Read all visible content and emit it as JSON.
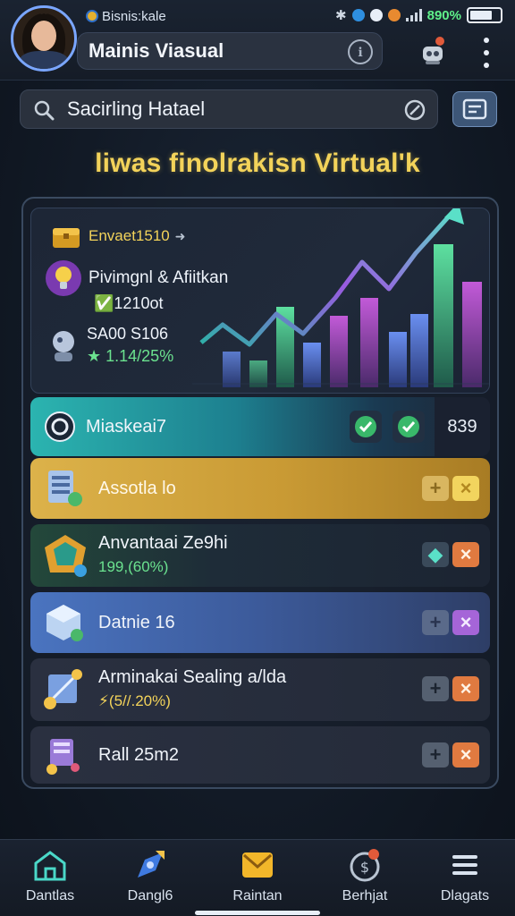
{
  "status": {
    "app_label": "Bisnis:kale",
    "battery_text": "890%"
  },
  "header": {
    "title": "Mainis Viasual"
  },
  "search": {
    "value": "Sacirling Hatael"
  },
  "headline": "liwas finolrakisn Virtual'k",
  "hero": {
    "badge": "Envaet1510",
    "line1": "Pivimgnl & Afiitkan",
    "line2": "✅1210ot",
    "line3": "SA00 S106",
    "line4": "★ 1.14/25%"
  },
  "rows": [
    {
      "label": "Miaskeai7",
      "count": "839"
    },
    {
      "label": "Assotla lo"
    },
    {
      "label": "Anvantaai Ze9hi",
      "sub": "199,(60%)"
    },
    {
      "label": "Datnie 16"
    },
    {
      "label": "Arminakai Sealing a/lda",
      "sub": "⚡(5//.20%)"
    },
    {
      "label": "Rall 25m2"
    }
  ],
  "nav": [
    {
      "label": "Dantlas",
      "icon": "home-icon"
    },
    {
      "label": "Dangl6",
      "icon": "rocket-icon"
    },
    {
      "label": "Raintan",
      "icon": "mail-icon"
    },
    {
      "label": "Berhjat",
      "icon": "coin-icon"
    },
    {
      "label": "Dlagats",
      "icon": "menu-icon"
    }
  ],
  "colors": {
    "accent_gold": "#f3d35a",
    "accent_green": "#6be28f",
    "teal_row": "#1d8a95",
    "gold_row": "#c79d34",
    "blue_row": "#3e5fa0"
  }
}
